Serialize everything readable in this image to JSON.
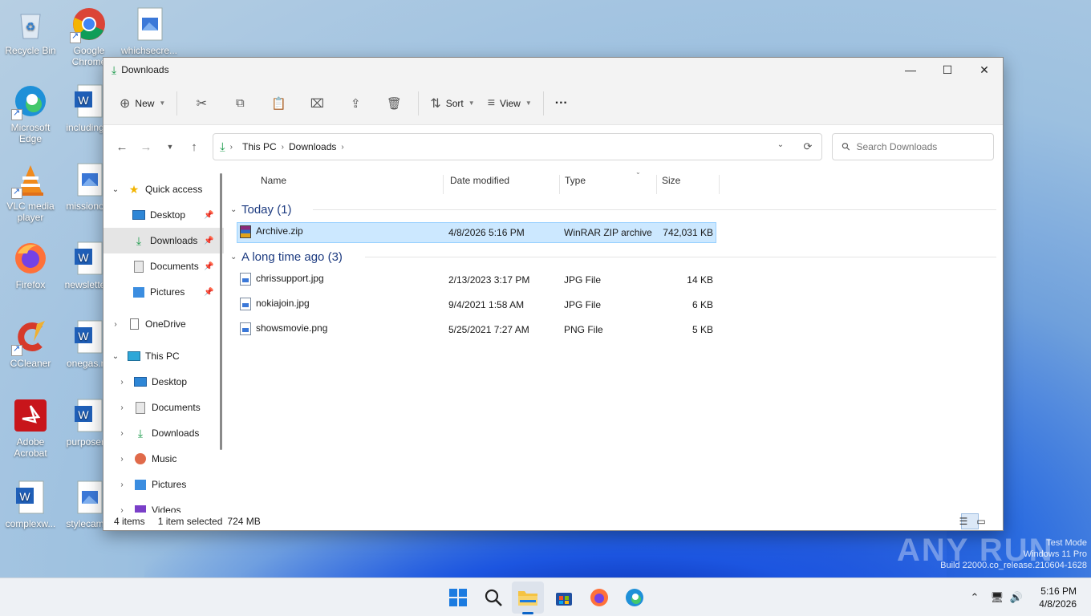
{
  "desktop": {
    "icons": [
      {
        "label": "Recycle Bin"
      },
      {
        "label": "Google Chrome"
      },
      {
        "label": "whichsecre..."
      },
      {
        "label": "Microsoft Edge"
      },
      {
        "label": "including..."
      },
      {
        "label": "VLC media player"
      },
      {
        "label": "missiono..."
      },
      {
        "label": "Firefox"
      },
      {
        "label": "newslette..."
      },
      {
        "label": "CCleaner"
      },
      {
        "label": "onegas.r..."
      },
      {
        "label": "Adobe Acrobat"
      },
      {
        "label": "purposer..."
      },
      {
        "label": "complexw..."
      },
      {
        "label": "stylecam..."
      }
    ]
  },
  "window": {
    "title": "Downloads",
    "controls": {
      "minimize": "—",
      "maximize": "☐",
      "close": "✕"
    }
  },
  "commandbar": {
    "new_label": "New",
    "sort_label": "Sort",
    "view_label": "View",
    "more_label": "···"
  },
  "address": {
    "segments": [
      "This PC",
      "Downloads"
    ],
    "search_placeholder": "Search Downloads"
  },
  "navpane": {
    "items": [
      {
        "label": "Quick access"
      },
      {
        "label": "Desktop"
      },
      {
        "label": "Downloads"
      },
      {
        "label": "Documents"
      },
      {
        "label": "Pictures"
      },
      {
        "label": "OneDrive"
      },
      {
        "label": "This PC"
      },
      {
        "label": "Desktop"
      },
      {
        "label": "Documents"
      },
      {
        "label": "Downloads"
      },
      {
        "label": "Music"
      },
      {
        "label": "Pictures"
      },
      {
        "label": "Videos"
      }
    ]
  },
  "columns": {
    "name": "Name",
    "date": "Date modified",
    "type": "Type",
    "size": "Size"
  },
  "groups": [
    {
      "label": "Today (1)",
      "files": [
        {
          "name": "Archive.zip",
          "date": "4/8/2026 5:16 PM",
          "type": "WinRAR ZIP archive",
          "size": "742,031 KB",
          "selected": true
        }
      ]
    },
    {
      "label": "A long time ago (3)",
      "files": [
        {
          "name": "chrissupport.jpg",
          "date": "2/13/2023 3:17 PM",
          "type": "JPG File",
          "size": "14 KB"
        },
        {
          "name": "nokiajoin.jpg",
          "date": "9/4/2021 1:58 AM",
          "type": "JPG File",
          "size": "6 KB"
        },
        {
          "name": "showsmovie.png",
          "date": "5/25/2021 7:27 AM",
          "type": "PNG File",
          "size": "5 KB"
        }
      ]
    }
  ],
  "status": {
    "items": "4 items",
    "selected": "1 item selected",
    "size": "724 MB"
  },
  "watermark": {
    "line1": "Test Mode",
    "line2": "Windows 11 Pro",
    "line3": "Build 22000.co_release.210604-1628",
    "brand": "ANY RUN"
  },
  "clock": {
    "time": "5:16 PM",
    "date": "4/8/2026"
  },
  "colors": {
    "accent": "#0a64c8",
    "selection": "#cce8ff",
    "download_green": "#1a9a4a"
  }
}
